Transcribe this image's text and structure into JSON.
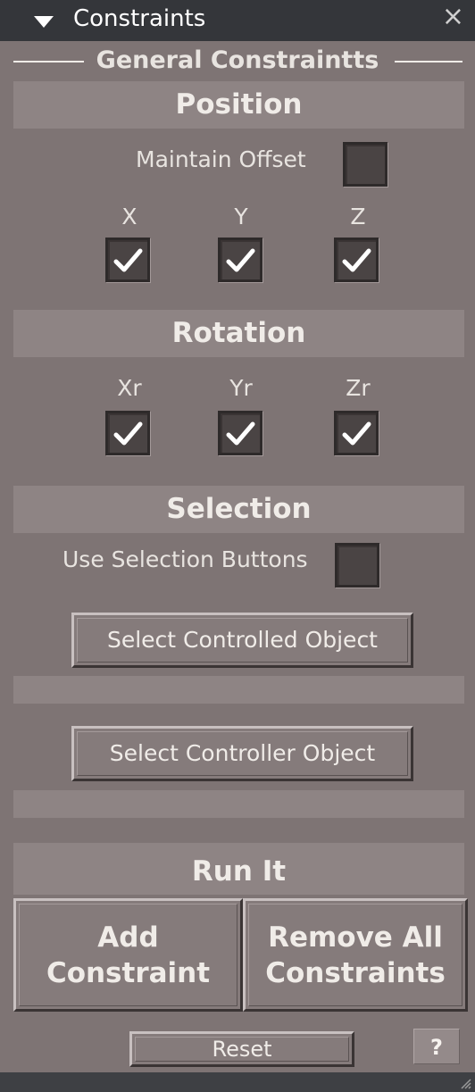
{
  "window": {
    "title": "Constraints",
    "close_glyph": "×",
    "collapse_icon": "triangle-down-icon"
  },
  "group": {
    "title": "General Constraintts"
  },
  "position": {
    "header": "Position",
    "maintain_offset": {
      "label": "Maintain Offset",
      "checked": false
    },
    "axes": [
      {
        "label": "X",
        "checked": true
      },
      {
        "label": "Y",
        "checked": true
      },
      {
        "label": "Z",
        "checked": true
      }
    ]
  },
  "rotation": {
    "header": "Rotation",
    "axes": [
      {
        "label": "Xr",
        "checked": true
      },
      {
        "label": "Yr",
        "checked": true
      },
      {
        "label": "Zr",
        "checked": true
      }
    ]
  },
  "selection": {
    "header": "Selection",
    "use_buttons": {
      "label": "Use Selection Buttons",
      "checked": false
    },
    "select_controlled": "Select Controlled Object",
    "select_controller": "Select Controller Object"
  },
  "run": {
    "header": "Run It",
    "add_line1": "Add",
    "add_line2": "Constraint",
    "remove_line1": "Remove All",
    "remove_line2": "Constraints",
    "reset": "Reset",
    "help": "?"
  },
  "colors": {
    "panel": "#7e7474",
    "header_band": "#8e8484",
    "titlebar": "#34363a",
    "checkbox": "#4a4444"
  }
}
